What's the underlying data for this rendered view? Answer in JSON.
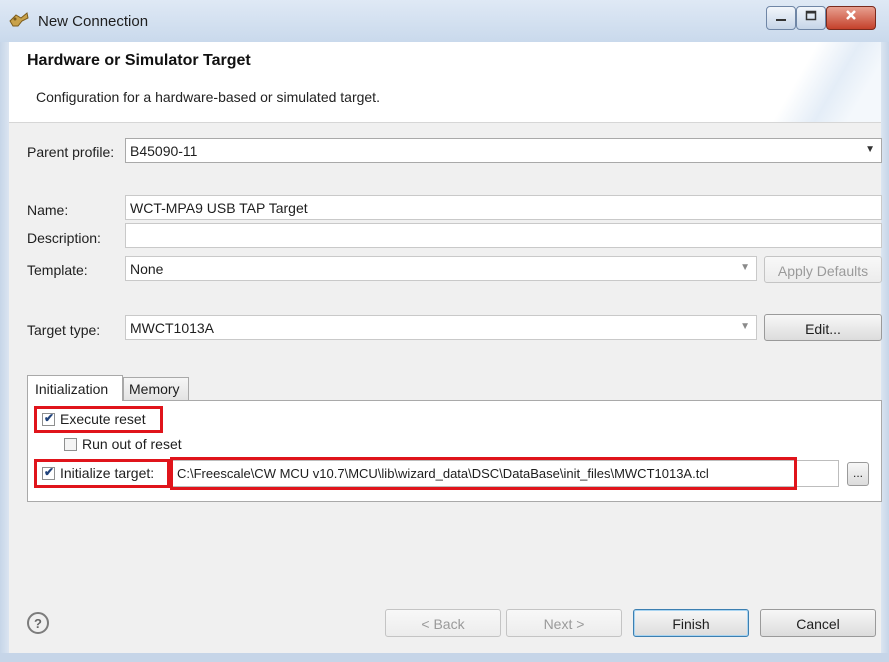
{
  "window": {
    "title": "New Connection",
    "minimize_icon": "minimize-icon",
    "maximize_icon": "maximize-icon",
    "close_icon": "close-icon"
  },
  "header": {
    "title": "Hardware or Simulator Target",
    "description": "Configuration for a hardware-based or simulated target."
  },
  "form": {
    "parent_profile_label": "Parent profile:",
    "parent_profile_value": "B45090-11",
    "name_label": "Name:",
    "name_value": "WCT-MPA9 USB TAP Target",
    "description_label": "Description:",
    "description_value": "",
    "template_label": "Template:",
    "template_value": "None",
    "apply_defaults_label": "Apply Defaults",
    "target_type_label": "Target type:",
    "target_type_value": "MWCT1013A",
    "edit_label": "Edit..."
  },
  "tabs": [
    {
      "label": "Initialization",
      "active": true
    },
    {
      "label": "Memory",
      "active": false
    }
  ],
  "initialization": {
    "execute_reset_label": "Execute reset",
    "execute_reset_checked": true,
    "run_out_of_reset_label": "Run out of reset",
    "run_out_of_reset_checked": false,
    "initialize_target_label": "Initialize target:",
    "initialize_target_checked": true,
    "init_file_path": "C:\\Freescale\\CW MCU v10.7\\MCU\\lib\\wizard_data\\DSC\\DataBase\\init_files\\MWCT1013A.tcl",
    "browse_label": "..."
  },
  "footer": {
    "help_glyph": "?",
    "back_label": "< Back",
    "next_label": "Next >",
    "finish_label": "Finish",
    "cancel_label": "Cancel"
  },
  "colors": {
    "highlight_red": "#e0141b",
    "title_bar": "#c9d9ec",
    "dialog_bg": "#f0f0f0"
  }
}
